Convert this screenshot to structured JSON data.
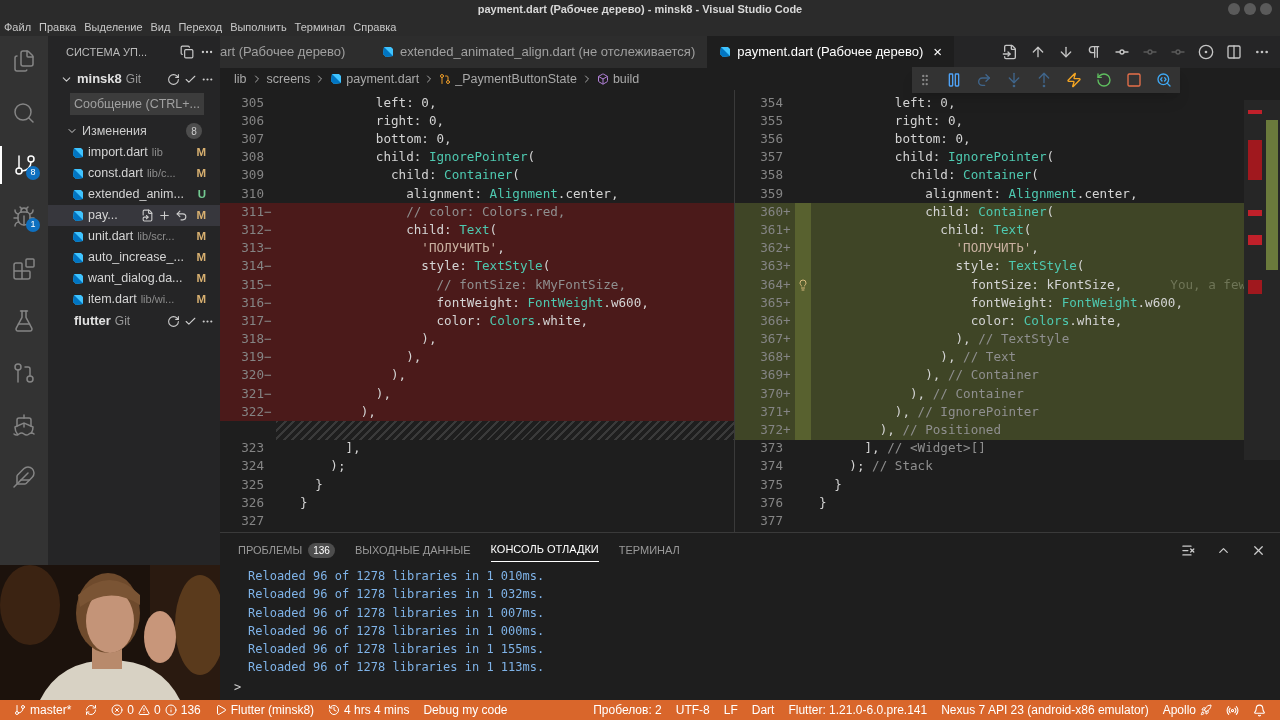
{
  "window": {
    "title": "payment.dart (Рабочее дерево) - minsk8 - Visual Studio Code"
  },
  "menu": [
    "Файл",
    "Правка",
    "Выделение",
    "Вид",
    "Переход",
    "Выполнить",
    "Терминал",
    "Справка"
  ],
  "activity_bar": [
    {
      "selected": false
    },
    {
      "selected": false
    },
    {
      "selected": true,
      "badge": "8"
    },
    {
      "selected": false,
      "badge": "1"
    },
    {
      "selected": false
    },
    {
      "selected": false
    },
    {
      "selected": false
    },
    {
      "selected": false
    },
    {
      "selected": false
    }
  ],
  "sidebar": {
    "title": "СИСТЕМА УП...",
    "repos": [
      {
        "name": "minsk8",
        "vcs": "Git",
        "expanded": true,
        "message_placeholder": "Сообщение (CTRL+...",
        "group": {
          "label": "Изменения",
          "count": "8",
          "expanded": true,
          "files": [
            {
              "name": "import.dart",
              "path": "lib",
              "status": "M",
              "kind": "modified",
              "selected": false
            },
            {
              "name": "const.dart",
              "path": "lib/c...",
              "status": "M",
              "kind": "modified",
              "selected": false
            },
            {
              "name": "extended_anim...",
              "status": "U",
              "kind": "untracked",
              "selected": false
            },
            {
              "name": "pay...",
              "status": "M",
              "kind": "modified",
              "selected": true
            },
            {
              "name": "unit.dart",
              "path": "lib/scr...",
              "status": "M",
              "kind": "modified",
              "selected": false
            },
            {
              "name": "auto_increase_...",
              "status": "M",
              "kind": "modified",
              "selected": false
            },
            {
              "name": "want_dialog.da...",
              "status": "M",
              "kind": "modified",
              "selected": false
            },
            {
              "name": "item.dart",
              "path": "lib/wi...",
              "status": "M",
              "kind": "modified",
              "selected": false
            }
          ]
        }
      },
      {
        "name": "flutter",
        "vcs": "Git",
        "expanded": false
      }
    ]
  },
  "tabs": [
    {
      "label": "art (Рабочее дерево)",
      "kind": "clipped",
      "selected": false
    },
    {
      "label": "extended_animated_align.dart (не отслеживается)",
      "kind": "full",
      "selected": false
    },
    {
      "label": "payment.dart (Рабочее дерево)",
      "kind": "full",
      "selected": true,
      "close": "×"
    }
  ],
  "editor_actions": [
    {
      "disabled": false
    },
    {
      "disabled": false
    },
    {
      "disabled": false
    },
    {
      "disabled": false
    },
    {
      "disabled": false
    },
    {
      "disabled": true
    },
    {
      "disabled": true
    },
    {
      "disabled": false
    },
    {
      "disabled": false
    },
    {
      "disabled": false
    }
  ],
  "breadcrumb": [
    {
      "text": "lib",
      "kind": "folder"
    },
    {
      "text": "screens",
      "kind": "folder"
    },
    {
      "text": "payment.dart",
      "kind": "file"
    },
    {
      "text": "_PaymentButtonState",
      "kind": "class"
    },
    {
      "text": "build",
      "kind": "method"
    }
  ],
  "debug_toolbar": [
    {
      "disabled": false
    },
    {
      "disabled": true
    },
    {
      "disabled": true
    },
    {
      "disabled": true
    },
    {
      "disabled": false
    },
    {
      "disabled": false
    },
    {
      "disabled": false
    },
    {
      "disabled": false
    }
  ],
  "diff": {
    "left": [
      {
        "no": "305",
        "kind": "context",
        "segments": [
          {
            "kind": "plain",
            "text": "          left: 0,"
          }
        ]
      },
      {
        "no": "306",
        "kind": "context",
        "segments": [
          {
            "kind": "plain",
            "text": "          right: 0,"
          }
        ]
      },
      {
        "no": "307",
        "kind": "context",
        "segments": [
          {
            "kind": "plain",
            "text": "          bottom: 0,"
          }
        ]
      },
      {
        "no": "308",
        "kind": "context",
        "segments": [
          {
            "kind": "plain",
            "text": "          child: "
          },
          {
            "kind": "class",
            "text": "IgnorePointer"
          },
          {
            "kind": "plain",
            "text": "("
          }
        ]
      },
      {
        "no": "309",
        "kind": "context",
        "segments": [
          {
            "kind": "plain",
            "text": "            child: "
          },
          {
            "kind": "class",
            "text": "Container"
          },
          {
            "kind": "plain",
            "text": "("
          }
        ]
      },
      {
        "no": "310",
        "kind": "context",
        "segments": [
          {
            "kind": "plain",
            "text": "              alignment: "
          },
          {
            "kind": "class",
            "text": "Alignment"
          },
          {
            "kind": "plain",
            "text": ".center,"
          }
        ]
      },
      {
        "no": "311",
        "sign": "−",
        "kind": "removed",
        "segments": [
          {
            "kind": "comment",
            "text": "              // color: Colors.red,"
          }
        ]
      },
      {
        "no": "312",
        "sign": "−",
        "kind": "removed",
        "segments": [
          {
            "kind": "plain",
            "text": "              child: "
          },
          {
            "kind": "class",
            "text": "Text"
          },
          {
            "kind": "plain",
            "text": "("
          }
        ]
      },
      {
        "no": "313",
        "sign": "−",
        "kind": "removed",
        "segments": [
          {
            "kind": "string",
            "text": "                'ПОЛУЧИТЬ'"
          },
          {
            "kind": "plain",
            "text": ","
          }
        ]
      },
      {
        "no": "314",
        "sign": "−",
        "kind": "removed",
        "segments": [
          {
            "kind": "plain",
            "text": "                style: "
          },
          {
            "kind": "class",
            "text": "TextStyle"
          },
          {
            "kind": "plain",
            "text": "("
          }
        ]
      },
      {
        "no": "315",
        "sign": "−",
        "kind": "removed",
        "segments": [
          {
            "kind": "comment",
            "text": "                  // fontSize: kMyFontSize,"
          }
        ]
      },
      {
        "no": "316",
        "sign": "−",
        "kind": "removed",
        "segments": [
          {
            "kind": "plain",
            "text": "                  fontWeight: "
          },
          {
            "kind": "class",
            "text": "FontWeight"
          },
          {
            "kind": "plain",
            "text": ".w600,"
          }
        ]
      },
      {
        "no": "317",
        "sign": "−",
        "kind": "removed",
        "segments": [
          {
            "kind": "plain",
            "text": "                  color: "
          },
          {
            "kind": "class",
            "text": "Colors"
          },
          {
            "kind": "plain",
            "text": ".white,"
          }
        ]
      },
      {
        "no": "318",
        "sign": "−",
        "kind": "removed",
        "segments": [
          {
            "kind": "plain",
            "text": "                ),"
          }
        ]
      },
      {
        "no": "319",
        "sign": "−",
        "kind": "removed",
        "segments": [
          {
            "kind": "plain",
            "text": "              ),"
          }
        ]
      },
      {
        "no": "320",
        "sign": "−",
        "kind": "removed",
        "segments": [
          {
            "kind": "plain",
            "text": "            ),"
          }
        ]
      },
      {
        "no": "321",
        "sign": "−",
        "kind": "removed",
        "segments": [
          {
            "kind": "plain",
            "text": "          ),"
          }
        ]
      },
      {
        "no": "322",
        "sign": "−",
        "kind": "removed",
        "segments": [
          {
            "kind": "plain",
            "text": "        ),"
          }
        ]
      },
      {
        "kind": "spacer"
      },
      {
        "no": "323",
        "kind": "context",
        "segments": [
          {
            "kind": "plain",
            "text": "      ],"
          }
        ]
      },
      {
        "no": "324",
        "kind": "context",
        "segments": [
          {
            "kind": "plain",
            "text": "    );"
          }
        ]
      },
      {
        "no": "325",
        "kind": "context",
        "segments": [
          {
            "kind": "plain",
            "text": "  }"
          }
        ]
      },
      {
        "no": "326",
        "kind": "context",
        "segments": [
          {
            "kind": "plain",
            "text": "}"
          }
        ]
      },
      {
        "no": "327",
        "kind": "context"
      }
    ],
    "right": [
      {
        "no": "354",
        "kind": "context",
        "segments": [
          {
            "kind": "plain",
            "text": "          left: 0,"
          }
        ]
      },
      {
        "no": "355",
        "kind": "context",
        "segments": [
          {
            "kind": "plain",
            "text": "          right: 0,"
          }
        ]
      },
      {
        "no": "356",
        "kind": "context",
        "segments": [
          {
            "kind": "plain",
            "text": "          bottom: 0,"
          }
        ]
      },
      {
        "no": "357",
        "kind": "context",
        "segments": [
          {
            "kind": "plain",
            "text": "          child: "
          },
          {
            "kind": "class",
            "text": "IgnorePointer"
          },
          {
            "kind": "plain",
            "text": "("
          }
        ]
      },
      {
        "no": "358",
        "kind": "context",
        "segments": [
          {
            "kind": "plain",
            "text": "            child: "
          },
          {
            "kind": "class",
            "text": "Container"
          },
          {
            "kind": "plain",
            "text": "("
          }
        ]
      },
      {
        "no": "359",
        "kind": "context",
        "segments": [
          {
            "kind": "plain",
            "text": "              alignment: "
          },
          {
            "kind": "class",
            "text": "Alignment"
          },
          {
            "kind": "plain",
            "text": ".center,"
          }
        ]
      },
      {
        "no": "360",
        "sign": "+",
        "kind": "added",
        "segments": [
          {
            "kind": "plain",
            "text": "              child: "
          },
          {
            "kind": "class",
            "text": "Container"
          },
          {
            "kind": "plain",
            "text": "("
          }
        ]
      },
      {
        "no": "361",
        "sign": "+",
        "kind": "added",
        "segments": [
          {
            "kind": "plain",
            "text": "                child: "
          },
          {
            "kind": "class",
            "text": "Text"
          },
          {
            "kind": "plain",
            "text": "("
          }
        ]
      },
      {
        "no": "362",
        "sign": "+",
        "kind": "added",
        "segments": [
          {
            "kind": "string",
            "text": "                  'ПОЛУЧИТЬ'"
          },
          {
            "kind": "plain",
            "text": ","
          }
        ]
      },
      {
        "no": "363",
        "sign": "+",
        "kind": "added",
        "segments": [
          {
            "kind": "plain",
            "text": "                  style: "
          },
          {
            "kind": "class",
            "text": "TextStyle"
          },
          {
            "kind": "plain",
            "text": "("
          }
        ]
      },
      {
        "no": "364",
        "sign": "+",
        "kind": "added",
        "lightbulb": true,
        "blame": "You, a few",
        "segments": [
          {
            "kind": "plain",
            "text": "                    fontSize: kFontSize,"
          }
        ]
      },
      {
        "no": "365",
        "sign": "+",
        "kind": "added",
        "segments": [
          {
            "kind": "plain",
            "text": "                    fontWeight: "
          },
          {
            "kind": "class",
            "text": "FontWeight"
          },
          {
            "kind": "plain",
            "text": ".w600,"
          }
        ]
      },
      {
        "no": "366",
        "sign": "+",
        "kind": "added",
        "segments": [
          {
            "kind": "plain",
            "text": "                    color: "
          },
          {
            "kind": "class",
            "text": "Colors"
          },
          {
            "kind": "plain",
            "text": ".white,"
          }
        ]
      },
      {
        "no": "367",
        "sign": "+",
        "kind": "added",
        "segments": [
          {
            "kind": "plain",
            "text": "                  ), "
          },
          {
            "kind": "comment",
            "text": "// TextStyle"
          }
        ]
      },
      {
        "no": "368",
        "sign": "+",
        "kind": "added",
        "segments": [
          {
            "kind": "plain",
            "text": "                ), "
          },
          {
            "kind": "comment",
            "text": "// Text"
          }
        ]
      },
      {
        "no": "369",
        "sign": "+",
        "kind": "added",
        "segments": [
          {
            "kind": "plain",
            "text": "              ), "
          },
          {
            "kind": "comment",
            "text": "// Container"
          }
        ]
      },
      {
        "no": "370",
        "sign": "+",
        "kind": "added",
        "segments": [
          {
            "kind": "plain",
            "text": "            ), "
          },
          {
            "kind": "comment",
            "text": "// Container"
          }
        ]
      },
      {
        "no": "371",
        "sign": "+",
        "kind": "added",
        "segments": [
          {
            "kind": "plain",
            "text": "          ), "
          },
          {
            "kind": "comment",
            "text": "// IgnorePointer"
          }
        ]
      },
      {
        "no": "372",
        "sign": "+",
        "kind": "added",
        "segments": [
          {
            "kind": "plain",
            "text": "        ), "
          },
          {
            "kind": "comment",
            "text": "// Positioned"
          }
        ]
      },
      {
        "no": "373",
        "kind": "context",
        "segments": [
          {
            "kind": "plain",
            "text": "      ], "
          },
          {
            "kind": "comment",
            "text": "// <Widget>[]"
          }
        ]
      },
      {
        "no": "374",
        "kind": "context",
        "segments": [
          {
            "kind": "plain",
            "text": "    ); "
          },
          {
            "kind": "comment",
            "text": "// Stack"
          }
        ]
      },
      {
        "no": "375",
        "kind": "context",
        "segments": [
          {
            "kind": "plain",
            "text": "  }"
          }
        ]
      },
      {
        "no": "376",
        "kind": "context",
        "segments": [
          {
            "kind": "plain",
            "text": "}"
          }
        ]
      },
      {
        "no": "377",
        "kind": "context"
      }
    ]
  },
  "panel": {
    "tabs": [
      {
        "label": "ПРОБЛЕМЫ",
        "badge": "136",
        "selected": false
      },
      {
        "label": "ВЫХОДНЫЕ ДАННЫЕ",
        "selected": false
      },
      {
        "label": "КОНСОЛЬ ОТЛАДКИ",
        "selected": true
      },
      {
        "label": "ТЕРМИНАЛ",
        "selected": false
      }
    ],
    "output": [
      "Reloaded 96 of 1278 libraries in 1 010ms.",
      "Reloaded 96 of 1278 libraries in 1 032ms.",
      "Reloaded 96 of 1278 libraries in 1 007ms.",
      "Reloaded 96 of 1278 libraries in 1 000ms.",
      "Reloaded 96 of 1278 libraries in 1 155ms.",
      "Reloaded 96 of 1278 libraries in 1 113ms."
    ],
    "prompt": ">"
  },
  "status_bar": {
    "left": [
      {
        "kind": "branch",
        "text": "master*"
      },
      {
        "kind": "sync"
      },
      {
        "kind": "problems",
        "errors": "0",
        "warnings": "0",
        "infos": "136"
      },
      {
        "kind": "run",
        "text": "Flutter (minsk8)"
      },
      {
        "kind": "time",
        "text": "4 hrs 4 mins"
      },
      {
        "kind": "plain",
        "text": "Debug my code"
      }
    ],
    "right": [
      {
        "kind": "plain",
        "text": "Пробелов: 2"
      },
      {
        "kind": "plain",
        "text": "UTF-8"
      },
      {
        "kind": "plain",
        "text": "LF"
      },
      {
        "kind": "plain",
        "text": "Dart"
      },
      {
        "kind": "plain",
        "text": "Flutter: 1.21.0-6.0.pre.141"
      },
      {
        "kind": "plain",
        "text": "Nexus 7 API 23 (android-x86 emulator)"
      },
      {
        "kind": "rocket",
        "text": "Apollo"
      },
      {
        "kind": "broadcast"
      },
      {
        "kind": "bell"
      }
    ]
  }
}
